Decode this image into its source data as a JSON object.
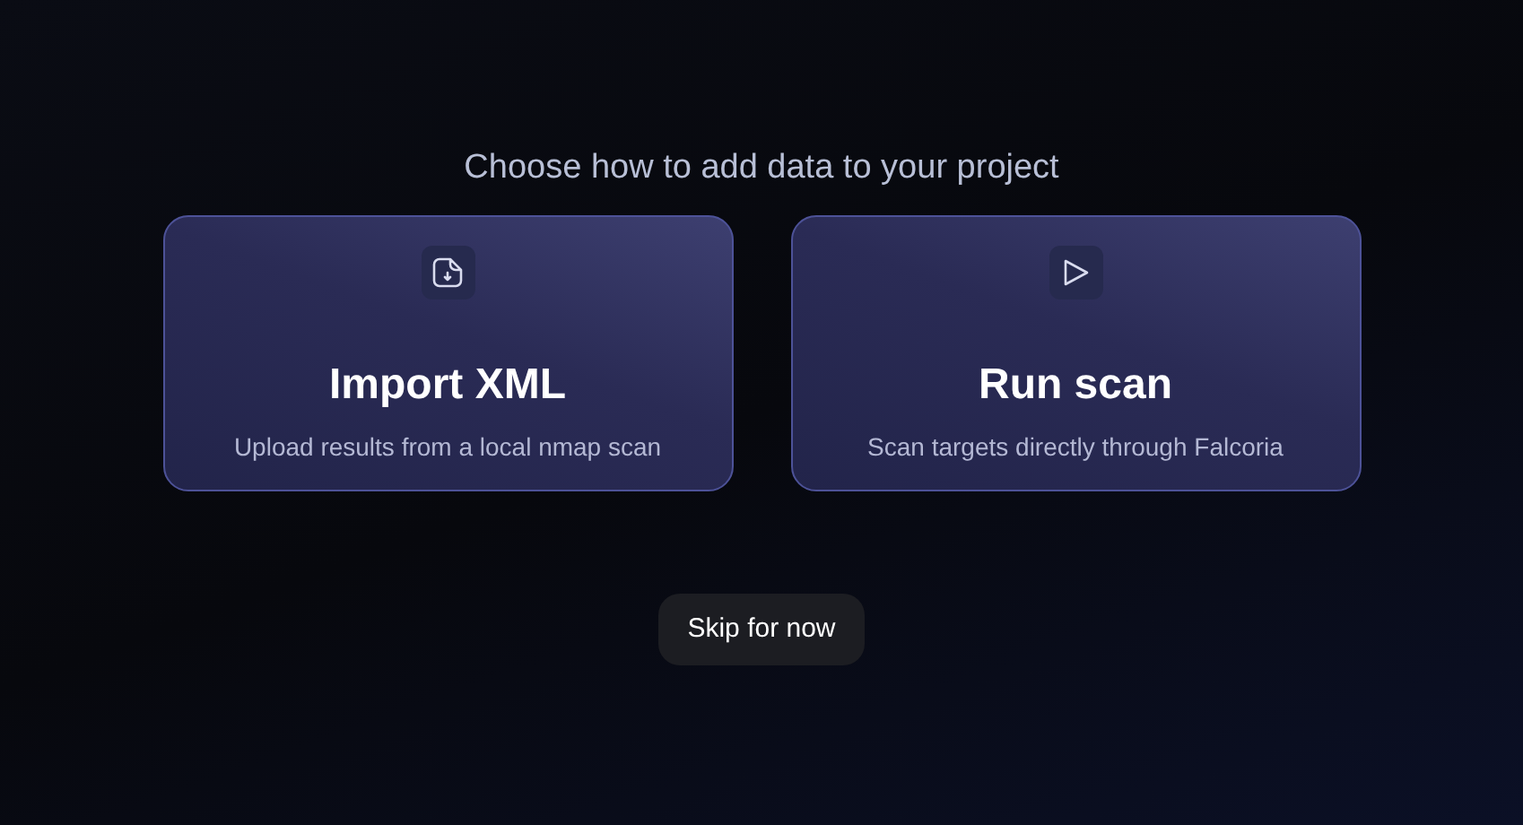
{
  "heading": "Choose how to add data to your project",
  "options": [
    {
      "kind": "import",
      "title": "Import XML",
      "description": "Upload results from a local nmap scan"
    },
    {
      "kind": "scan",
      "title": "Run scan",
      "description": "Scan targets directly through Falcoria"
    }
  ],
  "skip_button": "Skip for now"
}
